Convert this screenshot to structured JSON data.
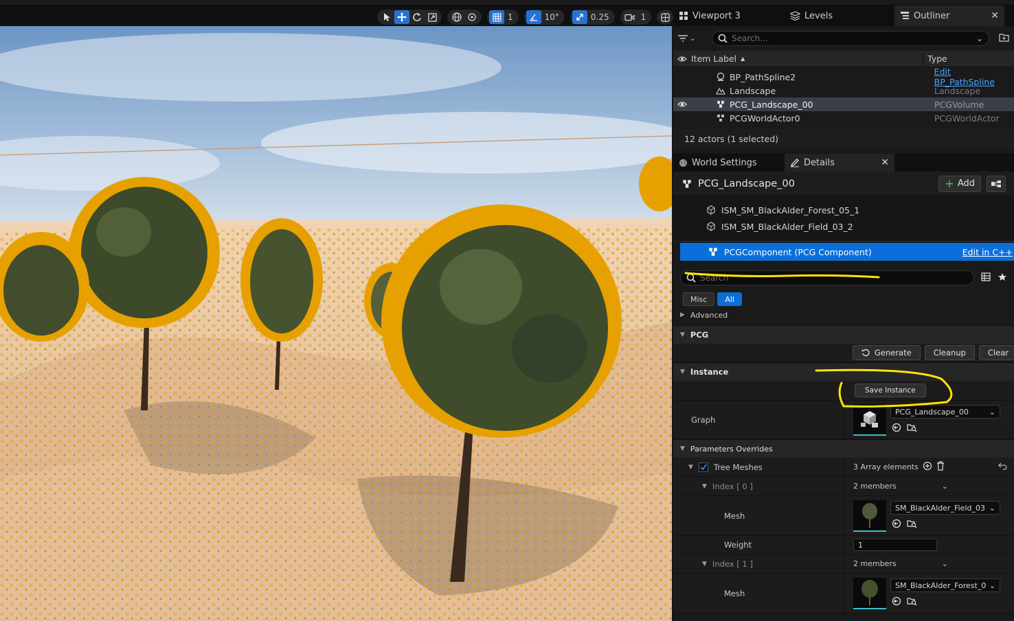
{
  "colors": {
    "accent": "#0b6fd9",
    "selection_outline": "#f5a300",
    "annotation": "#ffe600"
  },
  "viewport_toolbar": {
    "grid_snap": "1",
    "rotation_snap": "10°",
    "scale_snap": "0.25",
    "camera_speed": "1"
  },
  "tabs": {
    "viewport": "Viewport 3",
    "levels": "Levels",
    "outliner": "Outliner"
  },
  "outliner": {
    "search_placeholder": "Search...",
    "col_label": "Item Label",
    "col_type": "Type",
    "rows": [
      {
        "label": "BP_PathSpline2",
        "type": "Edit BP_PathSpline",
        "type_is_link": true
      },
      {
        "label": "Landscape",
        "type": "Landscape"
      },
      {
        "label": "PCG_Landscape_00",
        "type": "PCGVolume",
        "selected": true
      },
      {
        "label": "PCGWorldActor0",
        "type": "PCGWorldActor"
      }
    ],
    "footer": "12 actors (1 selected)"
  },
  "details_tabs": {
    "world_settings": "World Settings",
    "details": "Details"
  },
  "details": {
    "actor_name": "PCG_Landscape_00",
    "add_label": "Add",
    "components": [
      {
        "label": "ISM_SM_BlackAlder_Forest_05_1"
      },
      {
        "label": "ISM_SM_BlackAlder_Field_03_2"
      }
    ],
    "selected_component": "PCGComponent (PCG Component)",
    "edit_cpp": "Edit in C++",
    "search_placeholder": "Search",
    "filters": {
      "misc": "Misc",
      "all": "All"
    },
    "advanced": "Advanced",
    "categories": {
      "pcg": "PCG",
      "instance": "Instance",
      "param_overrides": "Parameters Overrides"
    },
    "pcg_buttons": {
      "generate": "Generate",
      "cleanup": "Cleanup",
      "clear": "Clear"
    },
    "save_instance": "Save Instance",
    "graph_label": "Graph",
    "graph_value": "PCG_Landscape_00",
    "tree_meshes": {
      "label": "Tree Meshes",
      "value": "3 Array elements"
    },
    "index0": {
      "label": "Index [ 0 ]",
      "value": "2 members",
      "mesh_label": "Mesh",
      "mesh_value": "SM_BlackAlder_Field_03",
      "weight_label": "Weight",
      "weight_value": "1"
    },
    "index1": {
      "label": "Index [ 1 ]",
      "value": "2 members",
      "mesh_label": "Mesh",
      "mesh_value": "SM_BlackAlder_Forest_0"
    }
  }
}
